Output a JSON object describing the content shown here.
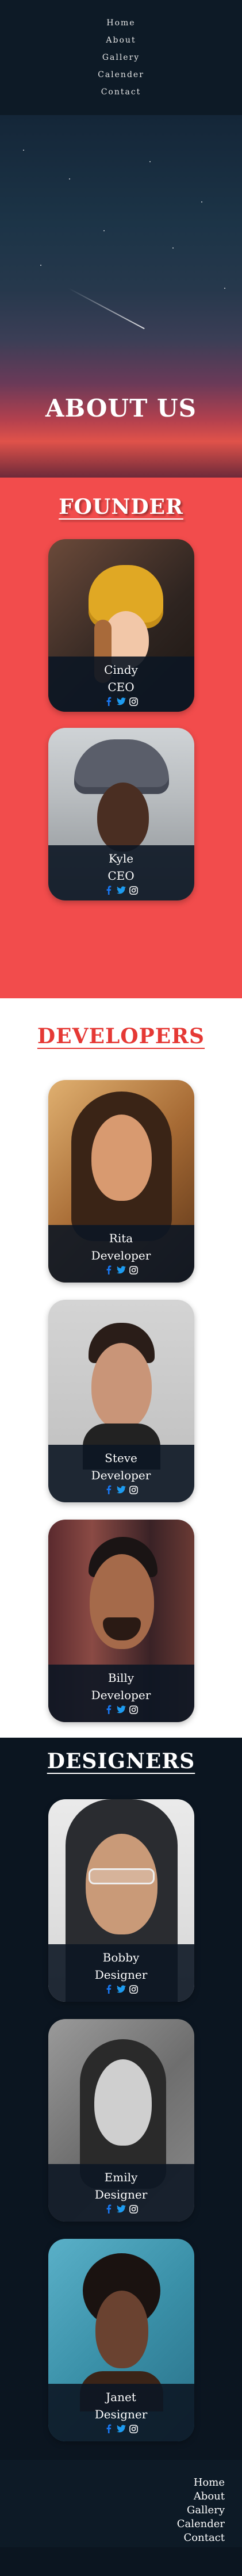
{
  "nav": {
    "items": [
      "Home",
      "About",
      "Gallery",
      "Calender",
      "Contact"
    ]
  },
  "hero": {
    "title": "ABOUT US"
  },
  "founder": {
    "title": "FOUNDER",
    "members": [
      {
        "name": "Cindy",
        "role": "CEO"
      },
      {
        "name": "Kyle",
        "role": "CEO"
      }
    ]
  },
  "developers": {
    "title": "DEVELOPERS",
    "members": [
      {
        "name": "Rita",
        "role": "Developer"
      },
      {
        "name": "Steve",
        "role": "Developer"
      },
      {
        "name": "Billy",
        "role": "Developer"
      }
    ]
  },
  "designers": {
    "title": "DESIGNERS",
    "members": [
      {
        "name": "Bobby",
        "role": "Designer"
      },
      {
        "name": "Emily",
        "role": "Designer"
      },
      {
        "name": "Janet",
        "role": "Designer"
      }
    ]
  },
  "footer": {
    "items": [
      "Home",
      "About",
      "Gallery",
      "Calender",
      "Contact"
    ]
  },
  "colors": {
    "facebook": "#1877f2",
    "twitter": "#1d9bf0",
    "instagram": "#ffffff",
    "founder_bg": "#f24c4c",
    "developers_title": "#e53935"
  },
  "icons": [
    "facebook-icon",
    "twitter-icon",
    "instagram-icon"
  ]
}
